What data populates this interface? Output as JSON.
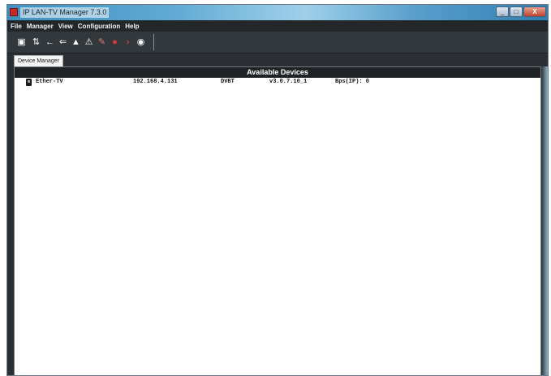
{
  "window": {
    "title": "IP LAN-TV Manager 7.3.0",
    "buttons": {
      "minimize": "_",
      "maximize": "□",
      "close": "X"
    }
  },
  "menu": [
    "File",
    "Manager",
    "View",
    "Configuration",
    "Help"
  ],
  "toolbar": {
    "icons": [
      {
        "name": "device-manager-icon",
        "glyph": "▣"
      },
      {
        "name": "network-icon",
        "glyph": "⇅"
      },
      {
        "name": "arrow-left-icon",
        "glyph": "←"
      },
      {
        "name": "arrow-left-double-icon",
        "glyph": "⇐"
      },
      {
        "name": "upload-icon",
        "glyph": "▲"
      },
      {
        "name": "warning-icon",
        "glyph": "⚠"
      },
      {
        "name": "plugin-icon",
        "glyph": "✎"
      },
      {
        "name": "record-icon",
        "glyph": "●"
      },
      {
        "name": "play-icon",
        "glyph": "›"
      },
      {
        "name": "eye-icon",
        "glyph": "◉"
      }
    ]
  },
  "tabs": {
    "device_manager": "Device Manager"
  },
  "devices": {
    "header": "Available Devices",
    "rows": [
      {
        "name": "Ether-TV",
        "ip": "192.168.4.131",
        "standard": "DVBT",
        "version": "v3.0.7.10_1",
        "status": "Bps(IP): 0"
      }
    ]
  },
  "colors": {
    "menu_bg": "#232729",
    "header_bg": "#202325",
    "title_gradient_mid": "#9fd0ea",
    "close_red": "#c2412b"
  }
}
